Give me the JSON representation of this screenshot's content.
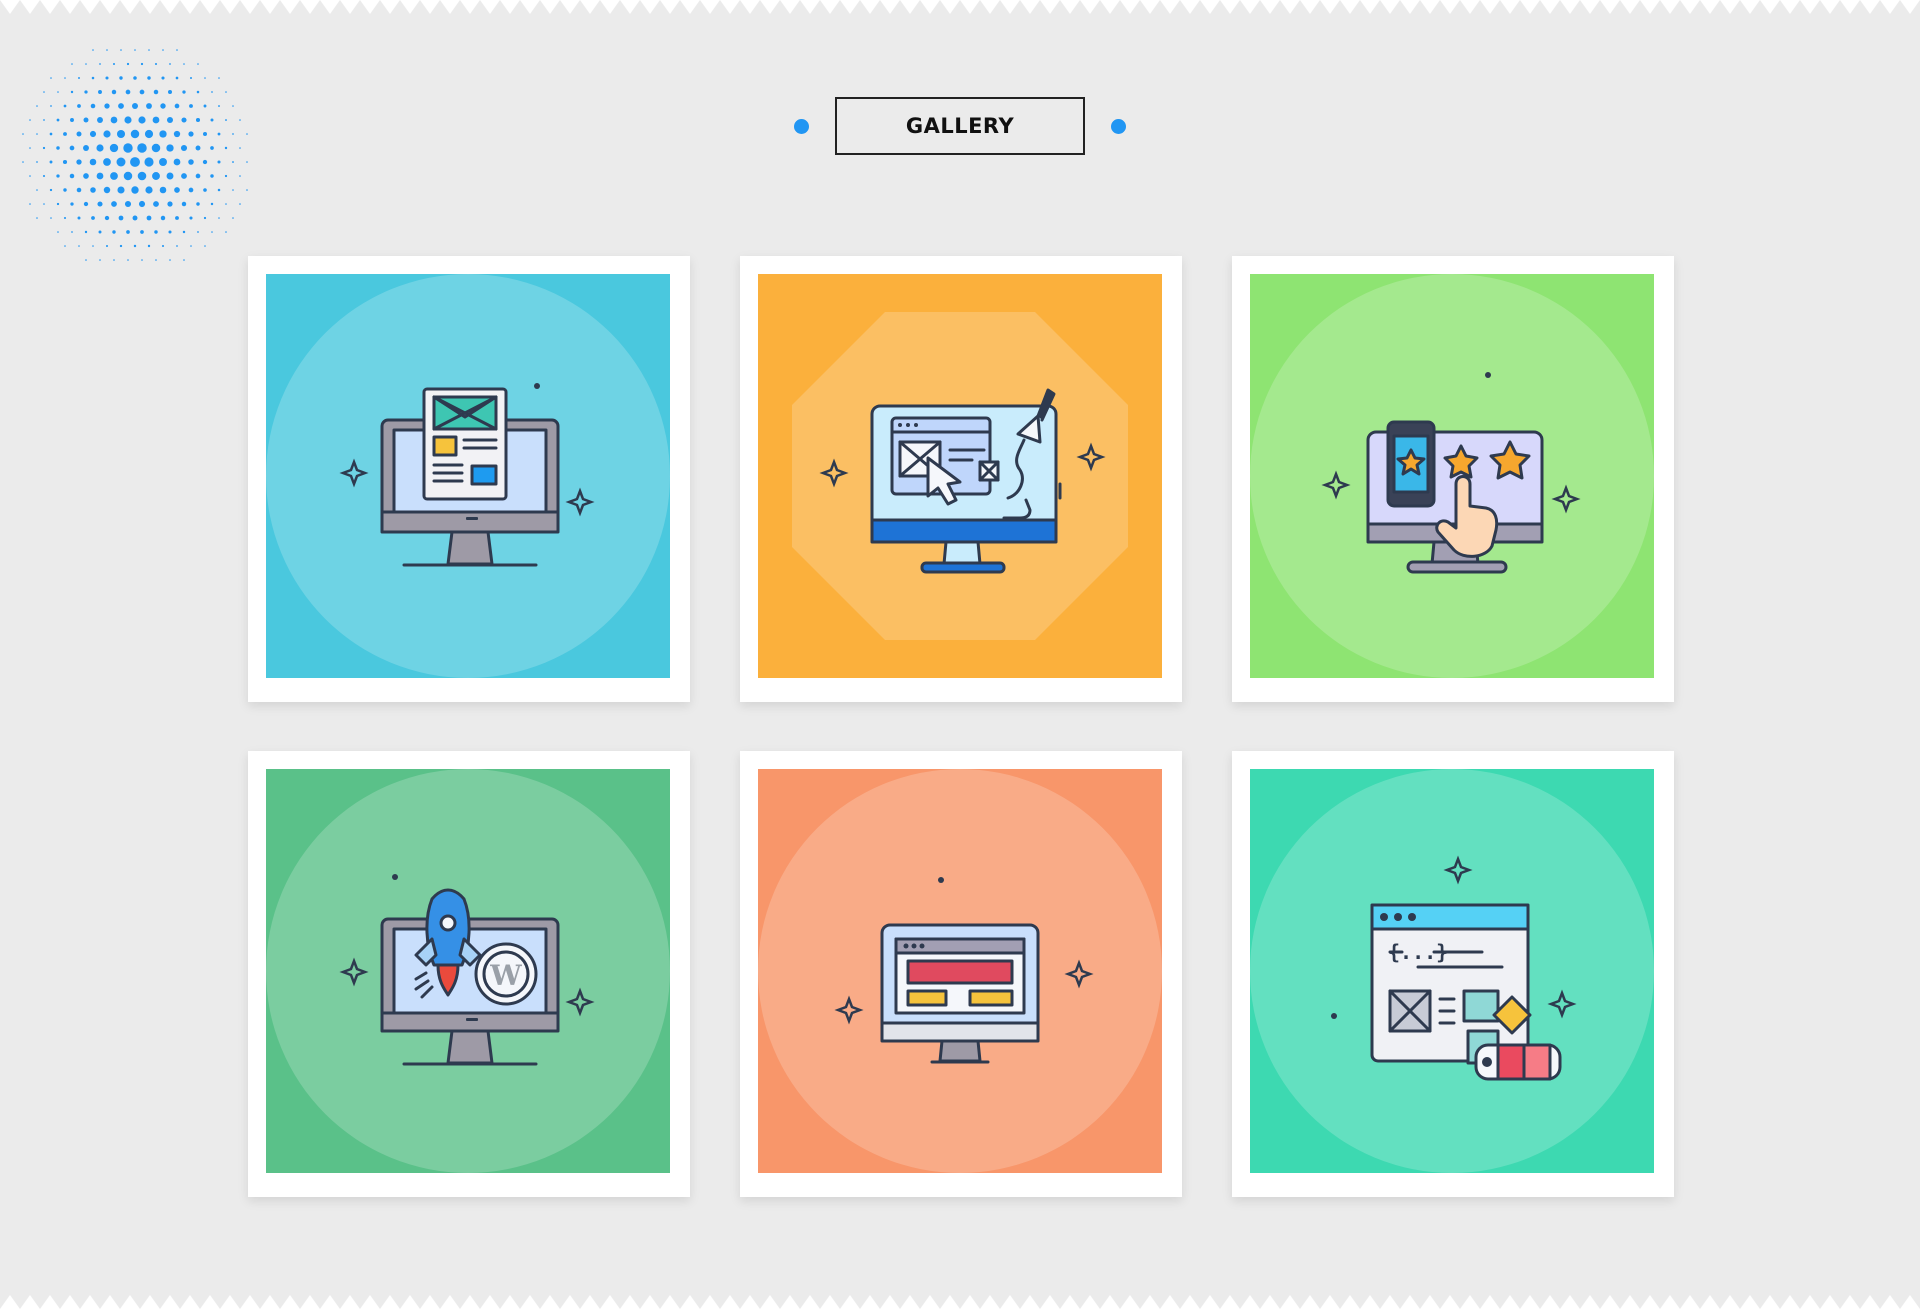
{
  "gallery": {
    "title": "GALLERY",
    "accent_color": "#2196f3",
    "items": [
      {
        "name": "monitor-newsletter",
        "icon": "monitor-layout-icon",
        "bg": "#4ac8de",
        "shape": "circle"
      },
      {
        "name": "monitor-design",
        "icon": "web-design-brush-icon",
        "bg": "#fbb03c",
        "shape": "octagon"
      },
      {
        "name": "monitor-rating",
        "icon": "rating-stars-icon",
        "bg": "#8ee472",
        "shape": "circle"
      },
      {
        "name": "monitor-wordpress",
        "icon": "wordpress-rocket-icon",
        "bg": "#5ac189",
        "shape": "circle"
      },
      {
        "name": "monitor-webpage",
        "icon": "webpage-monitor-icon",
        "bg": "#f8966a",
        "shape": "circle"
      },
      {
        "name": "code-palette",
        "icon": "code-palette-icon",
        "bg": "#3dd9b1",
        "shape": "circle"
      }
    ]
  }
}
